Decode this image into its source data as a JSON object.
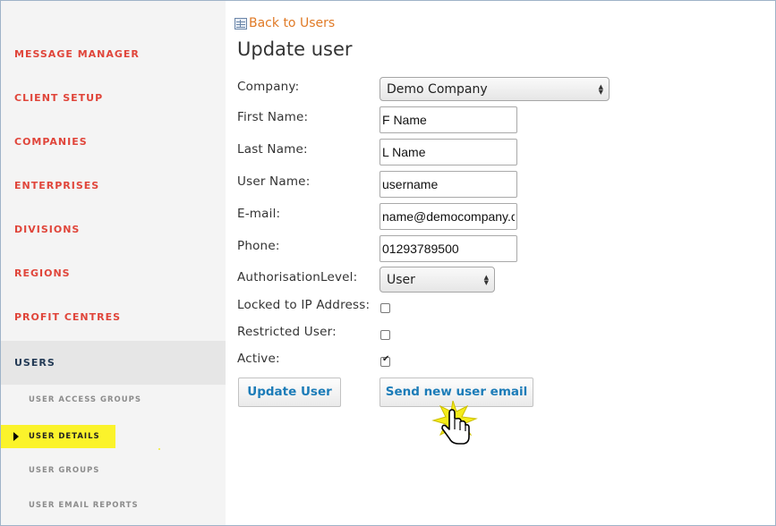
{
  "sidebar": {
    "items": [
      {
        "label": "MESSAGE MANAGER"
      },
      {
        "label": "CLIENT SETUP"
      },
      {
        "label": "COMPANIES"
      },
      {
        "label": "ENTERPRISES"
      },
      {
        "label": "DIVISIONS"
      },
      {
        "label": "REGIONS"
      },
      {
        "label": "PROFIT CENTRES"
      },
      {
        "label": "USERS"
      }
    ],
    "sub_items": [
      {
        "label": "USER ACCESS GROUPS"
      },
      {
        "label": "USER DETAILS"
      },
      {
        "label": "USER GROUPS"
      },
      {
        "label": "USER EMAIL REPORTS"
      }
    ],
    "active_item": "USERS",
    "highlighted_sub_item": "USER DETAILS"
  },
  "header": {
    "back_link": "Back to Users",
    "title": "Update user"
  },
  "form": {
    "company_label": "Company:",
    "company_value": "Demo Company",
    "first_name_label": "First Name:",
    "first_name_value": "F Name",
    "last_name_label": "Last Name:",
    "last_name_value": "L Name",
    "user_name_label": "User Name:",
    "user_name_value": "username",
    "email_label": "E-mail:",
    "email_value": "name@democompany.co",
    "phone_label": "Phone:",
    "phone_value": "01293789500",
    "auth_level_label": "AuthorisationLevel:",
    "auth_level_value": "User",
    "locked_ip_label": "Locked to IP Address:",
    "locked_ip_checked": false,
    "restricted_label": "Restricted User:",
    "restricted_checked": false,
    "active_label": "Active:",
    "active_checked": true
  },
  "buttons": {
    "update_user": "Update User",
    "send_email": "Send new user email"
  },
  "colors": {
    "nav_text": "#e0453a",
    "active_nav_text": "#233a55",
    "highlight": "#fbf32b",
    "link": "#e07a26",
    "button_text": "#1c7cb8"
  },
  "icons": {
    "back": "list-icon",
    "select": "up-down-arrows-icon",
    "cursor": "hand-pointer-icon",
    "sub_item_marker": "triangle-right-icon"
  }
}
